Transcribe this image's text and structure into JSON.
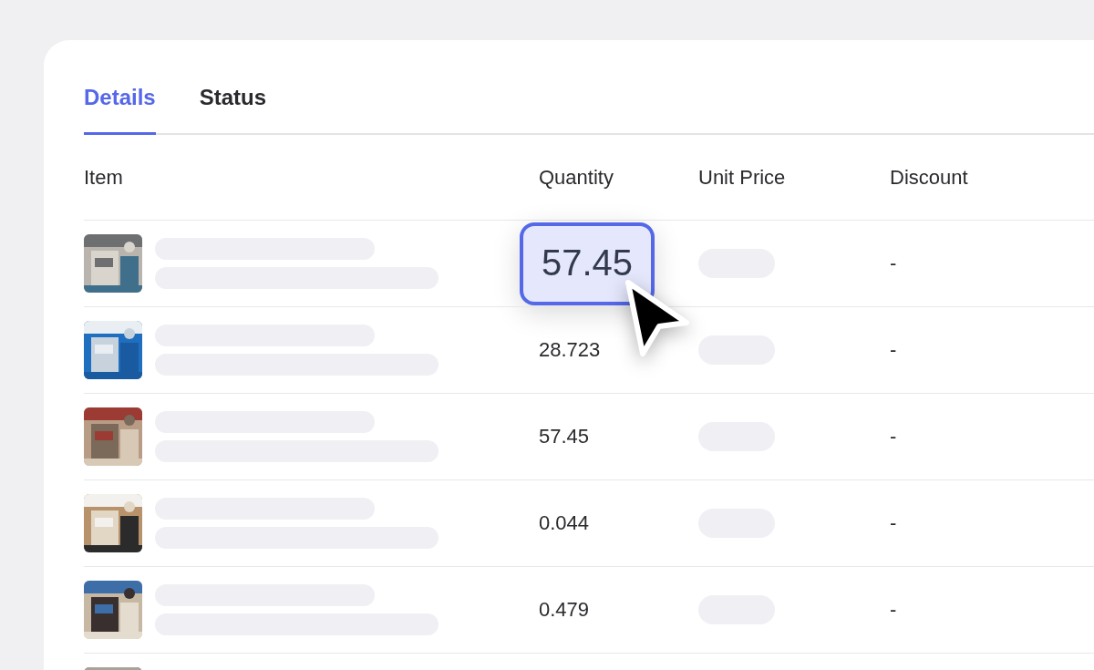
{
  "tabs": [
    {
      "label": "Details",
      "selected": true
    },
    {
      "label": "Status",
      "selected": false
    }
  ],
  "table": {
    "columns": [
      "Item",
      "Quantity",
      "Unit Price",
      "Discount"
    ],
    "rows": [
      {
        "thumbnail": {
          "kind": "picture"
        },
        "quantity": "57.45",
        "highlighted": true,
        "discount": "-"
      },
      {
        "thumbnail": {
          "kind": "picture"
        },
        "quantity": "28.723",
        "highlighted": false,
        "discount": "-"
      },
      {
        "thumbnail": {
          "kind": "picture"
        },
        "quantity": "57.45",
        "highlighted": false,
        "discount": "-"
      },
      {
        "thumbnail": {
          "kind": "picture"
        },
        "quantity": "0.044",
        "highlighted": false,
        "discount": "-"
      },
      {
        "thumbnail": {
          "kind": "picture"
        },
        "quantity": "0.479",
        "highlighted": false,
        "discount": "-"
      },
      {
        "thumbnail": {
          "kind": "picture"
        }
      }
    ]
  }
}
